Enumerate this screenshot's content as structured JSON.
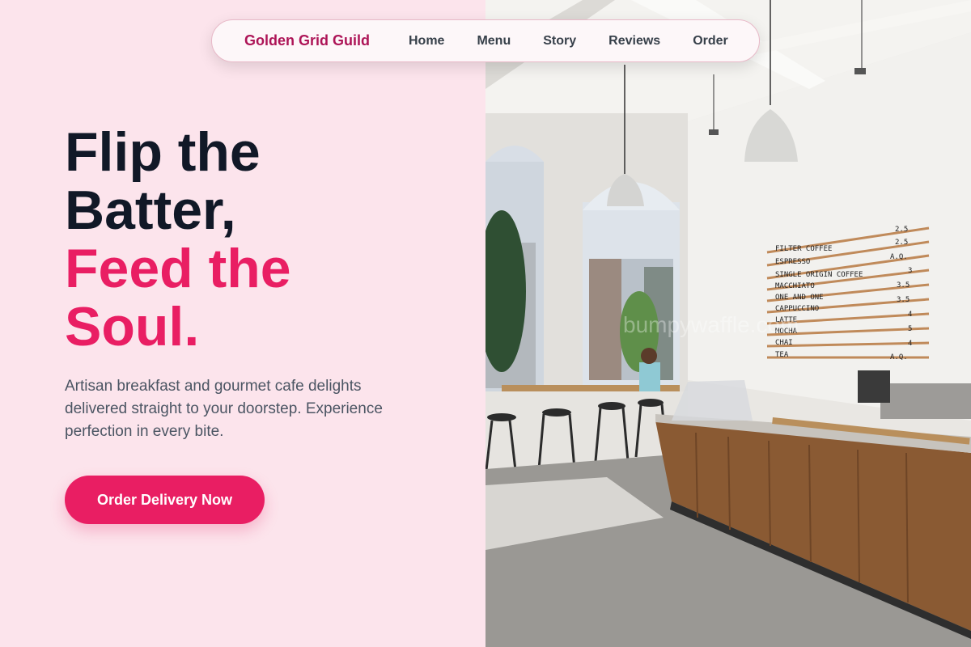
{
  "nav": {
    "brand": "Golden Grid Guild",
    "links": [
      "Home",
      "Menu",
      "Story",
      "Reviews",
      "Order"
    ]
  },
  "hero": {
    "headline_dark": [
      "Flip the",
      "Batter,"
    ],
    "headline_pink": [
      "Feed the",
      "Soul."
    ],
    "subtext": "Artisan breakfast and gourmet cafe delights delivered straight to your doorstep. Experience perfection in every bite.",
    "cta_label": "Order Delivery Now"
  },
  "photo": {
    "watermark": "bumpywaffle.com",
    "menu_board": [
      {
        "item": "FILTER COFFEE",
        "price": "2.5"
      },
      {
        "item": "ESPRESSO",
        "price": "2.5"
      },
      {
        "item": "SINGLE ORIGIN COFFEE",
        "price": "A.Q."
      },
      {
        "item": "MACCHIATO",
        "price": "3"
      },
      {
        "item": "ONE AND ONE",
        "price": "3.5"
      },
      {
        "item": "CAPPUCCINO",
        "price": "3.5"
      },
      {
        "item": "LATTE",
        "price": "4"
      },
      {
        "item": "MOCHA",
        "price": "5"
      },
      {
        "item": "CHAI",
        "price": "4"
      },
      {
        "item": "TEA",
        "price": "A.Q."
      }
    ]
  },
  "colors": {
    "background": "#fce4ec",
    "accent": "#e91e63",
    "brand": "#ad1457",
    "heading": "#111827",
    "body": "#4b5563"
  }
}
